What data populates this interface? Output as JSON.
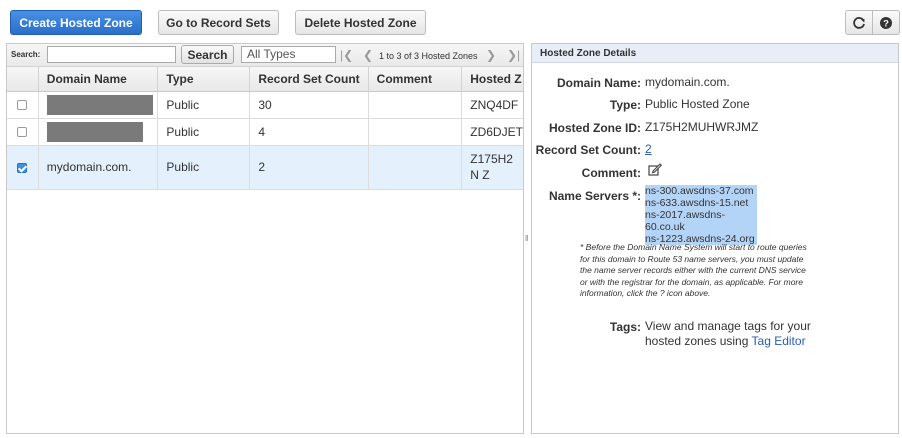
{
  "toolbar": {
    "create_label": "Create Hosted Zone",
    "goto_label": "Go to Record Sets",
    "delete_label": "Delete Hosted Zone"
  },
  "search": {
    "label": "Search:",
    "value": "",
    "button_label": "Search",
    "type_selected": "All Types"
  },
  "pager": {
    "text": "1 to 3 of 3 Hosted Zones"
  },
  "table": {
    "headers": [
      "Domain Name",
      "Type",
      "Record Set Count",
      "Comment",
      "Hosted Z"
    ],
    "rows": [
      {
        "domain": "",
        "type": "Public",
        "count": "30",
        "comment": "",
        "zone": "ZNQ4DF",
        "checked": false
      },
      {
        "domain": "",
        "type": "Public",
        "count": "4",
        "comment": "",
        "zone": "ZD6DJET",
        "checked": false
      },
      {
        "domain": "mydomain.com.",
        "type": "Public",
        "count": "2",
        "comment": "",
        "zone": "Z175H2N Z",
        "checked": true
      }
    ]
  },
  "details": {
    "title": "Hosted Zone Details",
    "domain_label": "Domain Name:",
    "domain_value": "mydomain.com.",
    "type_label": "Type:",
    "type_value": "Public Hosted Zone",
    "zone_id_label": "Hosted Zone ID:",
    "zone_id_value": "Z175H2MUHWRJMZ",
    "count_label": "Record Set Count:",
    "count_value": "2",
    "comment_label": "Comment:",
    "ns_label": "Name Servers *:",
    "name_servers": [
      "ns-300.awsdns-37.com",
      "ns-633.awsdns-15.net",
      "ns-2017.awsdns-60.co.uk",
      "ns-1223.awsdns-24.org"
    ],
    "note": "* Before the Domain Name System will start to route queries for this domain to Route 53 name servers, you must update the name server records either with the current DNS service or with the registrar for the domain, as applicable. For more information, click the ? icon above.",
    "tags_label": "Tags:",
    "tags_text": "View and manage tags for your hosted zones using",
    "tags_link": "Tag Editor"
  },
  "icons": {
    "refresh": "refresh-icon",
    "help": "help-icon",
    "edit": "edit-icon"
  }
}
